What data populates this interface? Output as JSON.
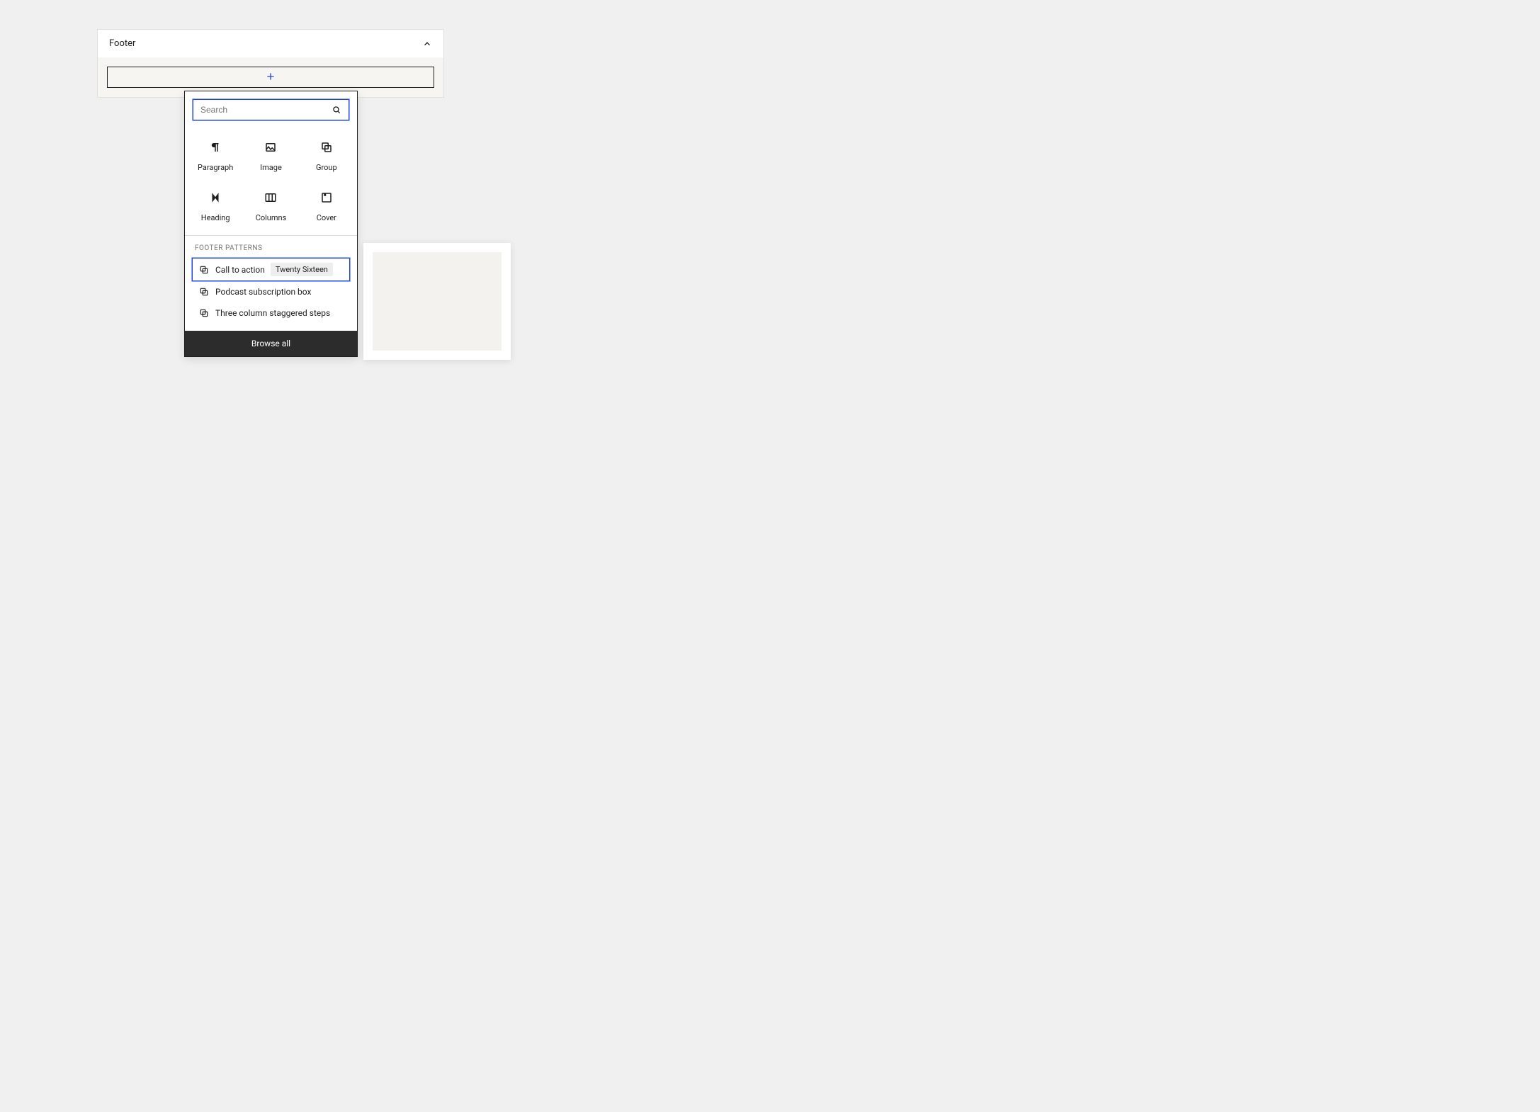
{
  "footer_panel": {
    "title": "Footer"
  },
  "inserter": {
    "search_placeholder": "Search",
    "blocks": [
      {
        "id": "paragraph",
        "label": "Paragraph"
      },
      {
        "id": "image",
        "label": "Image"
      },
      {
        "id": "group",
        "label": "Group"
      },
      {
        "id": "heading",
        "label": "Heading"
      },
      {
        "id": "columns",
        "label": "Columns"
      },
      {
        "id": "cover",
        "label": "Cover"
      }
    ],
    "patterns_heading": "FOOTER PATTERNS",
    "patterns": [
      {
        "label": "Call to action",
        "tag": "Twenty Sixteen",
        "selected": true
      },
      {
        "label": "Podcast subscription box",
        "tag": null,
        "selected": false
      },
      {
        "label": "Three column staggered steps",
        "tag": null,
        "selected": false
      }
    ],
    "browse_all": "Browse all"
  }
}
